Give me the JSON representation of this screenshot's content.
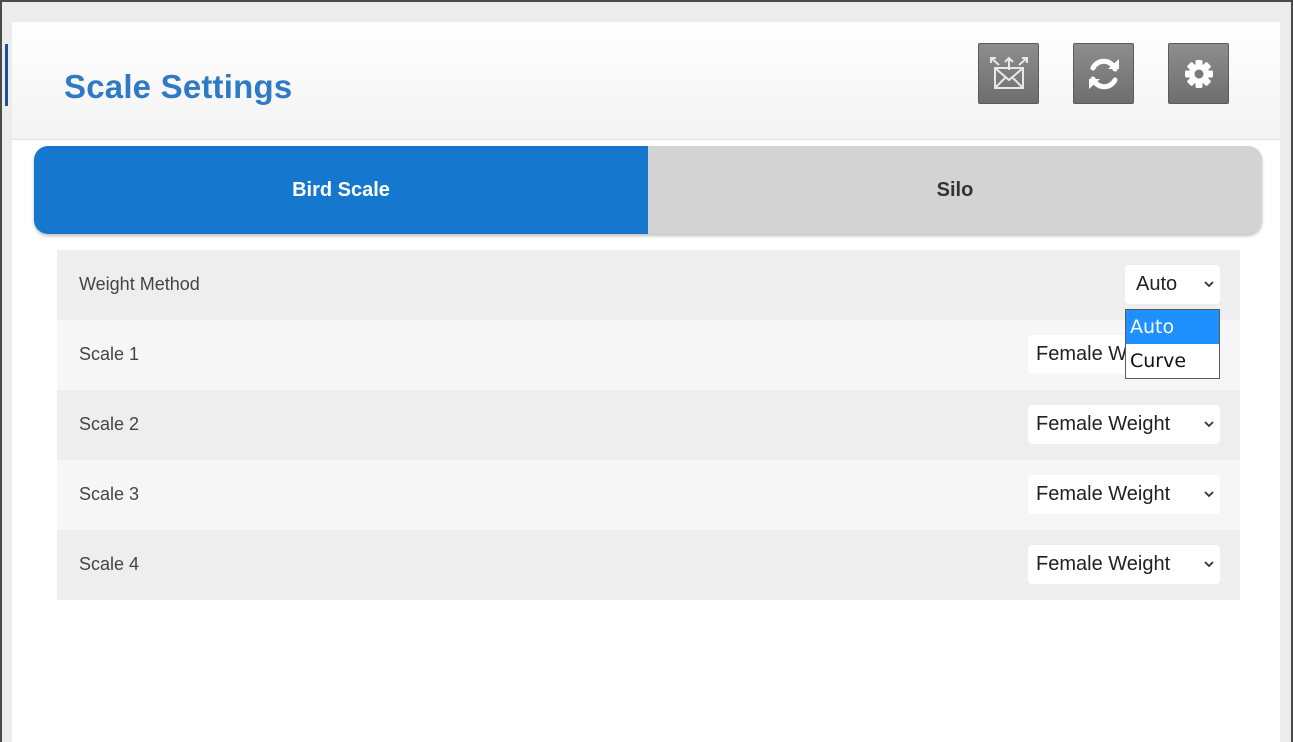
{
  "header": {
    "title": "Scale Settings",
    "buttons": [
      {
        "name": "mail-sync-button",
        "icon": "mail-arrows-icon"
      },
      {
        "name": "refresh-button",
        "icon": "refresh-icon"
      },
      {
        "name": "settings-button",
        "icon": "gear-icon"
      }
    ]
  },
  "tabs": [
    {
      "label": "Bird Scale",
      "active": true
    },
    {
      "label": "Silo",
      "active": false
    }
  ],
  "settings": {
    "weight_method": {
      "label": "Weight Method",
      "value": "Auto"
    },
    "scale1": {
      "label": "Scale 1",
      "value": "Female Weight"
    },
    "scale2": {
      "label": "Scale 2",
      "value": "Female Weight"
    },
    "scale3": {
      "label": "Scale 3",
      "value": "Female Weight"
    },
    "scale4": {
      "label": "Scale 4",
      "value": "Female Weight"
    }
  },
  "dropdown": {
    "options": [
      "Auto",
      "Curve"
    ],
    "selected": "Auto"
  },
  "colors": {
    "title": "#2f7ac6",
    "tab_active": "#1677cf",
    "tab_inactive": "#d3d3d3",
    "button": "#7d7d7d",
    "dropdown_highlight": "#1e90ff"
  }
}
